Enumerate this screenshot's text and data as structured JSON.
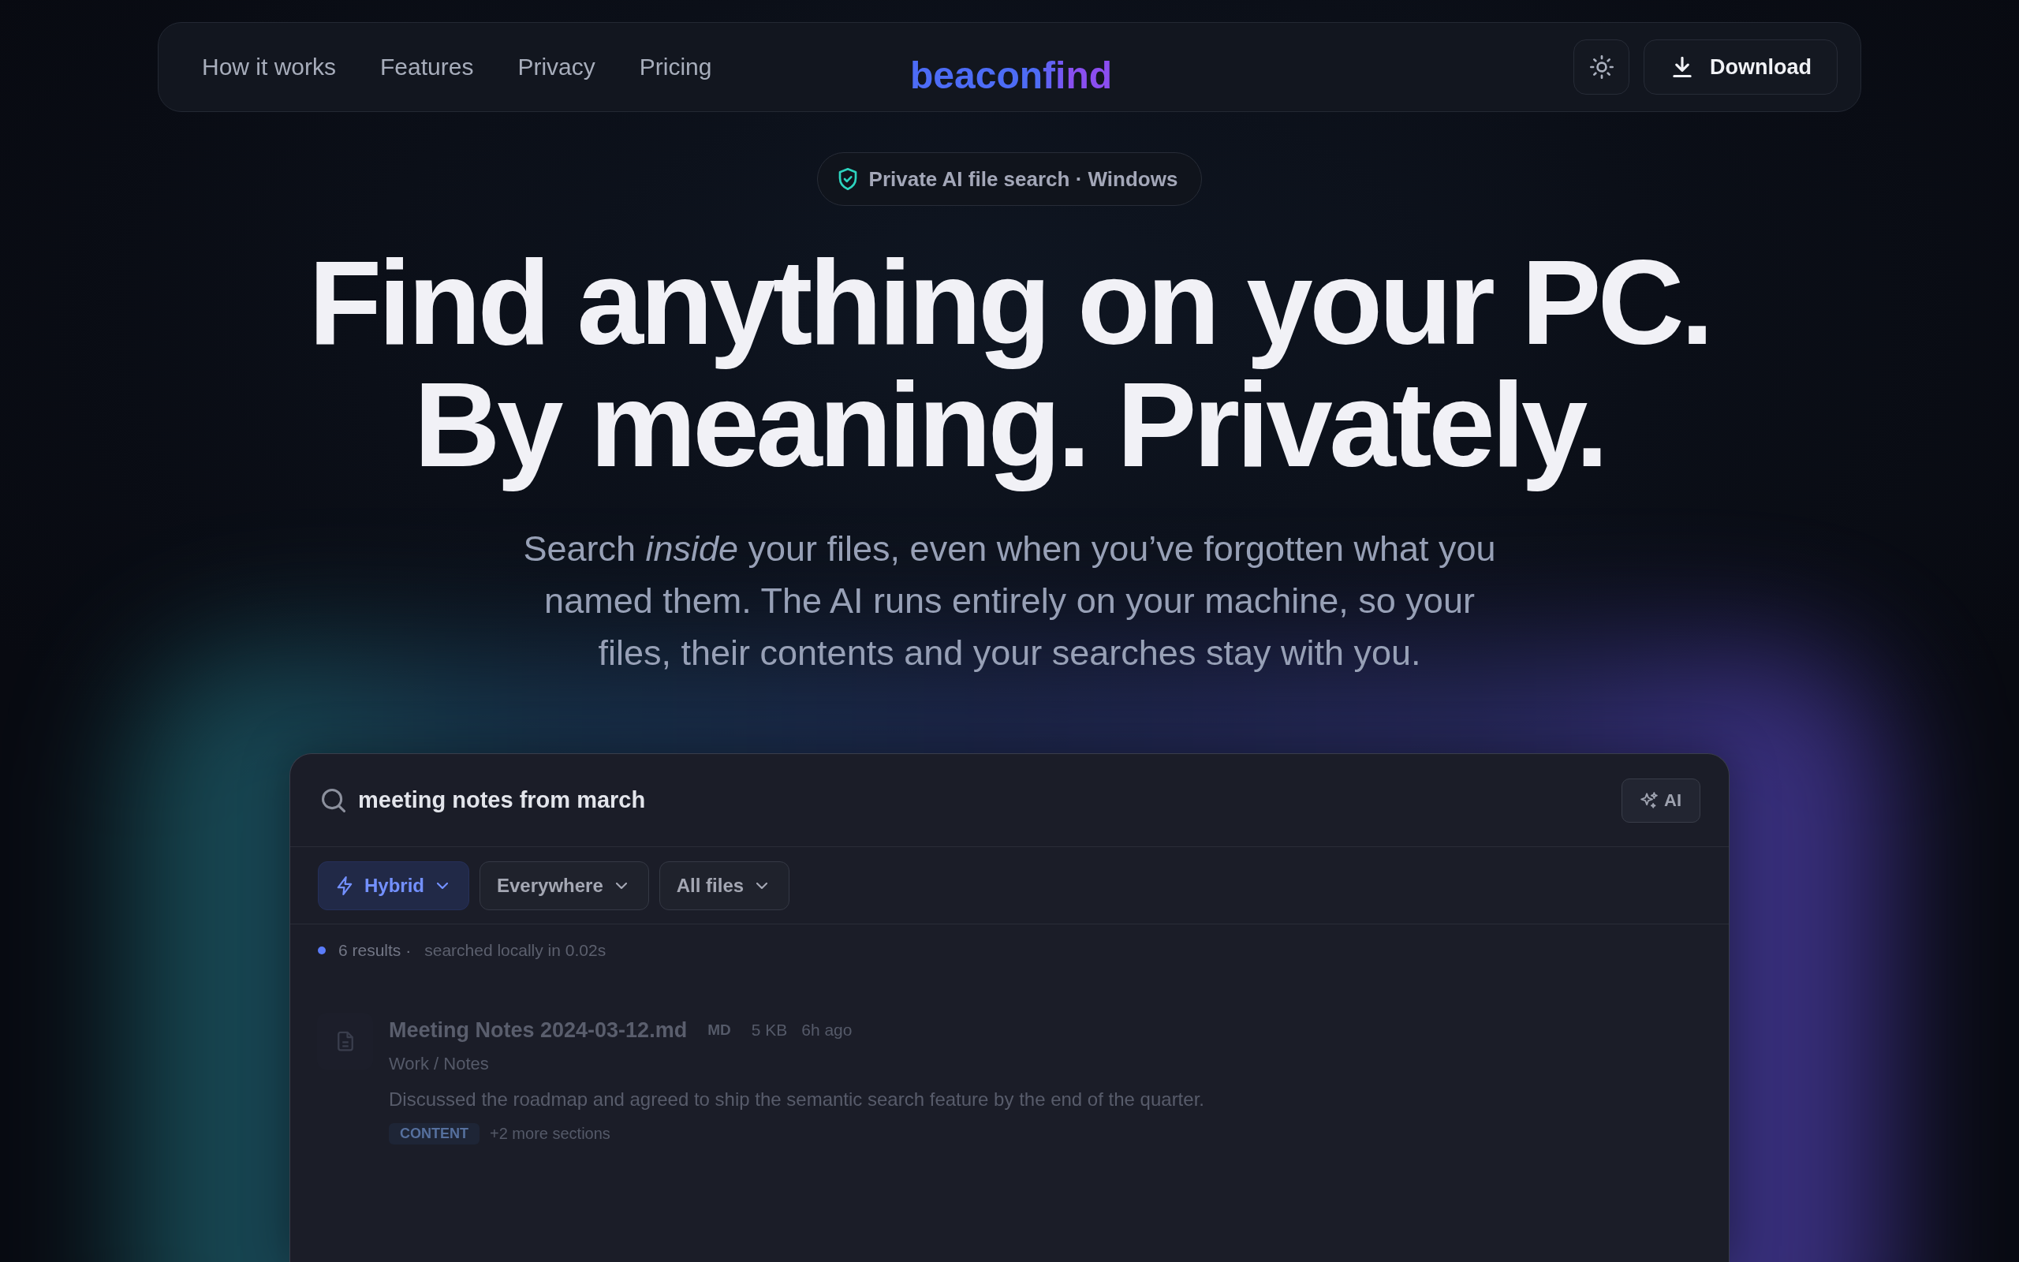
{
  "nav": {
    "links": [
      "How it works",
      "Features",
      "Privacy",
      "Pricing"
    ],
    "logo": "beaconfind",
    "download_button": "Download"
  },
  "badge": "Private AI file search · Windows",
  "headline": [
    "Find anything on your PC.",
    "By meaning. Privately."
  ],
  "subtitle": "Search *inside* your files, even when you’ve forgotten what you named them. The AI runs entirely on your machine, so your files, their contents and your searches stay with you.",
  "search_preview": {
    "query": "meeting notes from march",
    "ai_button": "AI",
    "filters": [
      {
        "label": "Hybrid",
        "kind": "mode",
        "selected": true
      },
      {
        "label": "Everywhere",
        "kind": "location",
        "selected": false
      },
      {
        "label": "All files",
        "kind": "file_type",
        "selected": false
      }
    ],
    "status": {
      "count": "6 results ·",
      "detail": "searched locally in 0.02s"
    },
    "results": [
      {
        "title": "Meeting Notes 2024-03-12.md",
        "type": "MD",
        "size": "5 KB",
        "age": "6h ago",
        "path": "Work / Notes",
        "snippet": "Discussed the roadmap and agreed to ship the semantic search feature by the end of the quarter.",
        "match_tag": "CONTENT",
        "more": "+2 more sections"
      }
    ]
  }
}
